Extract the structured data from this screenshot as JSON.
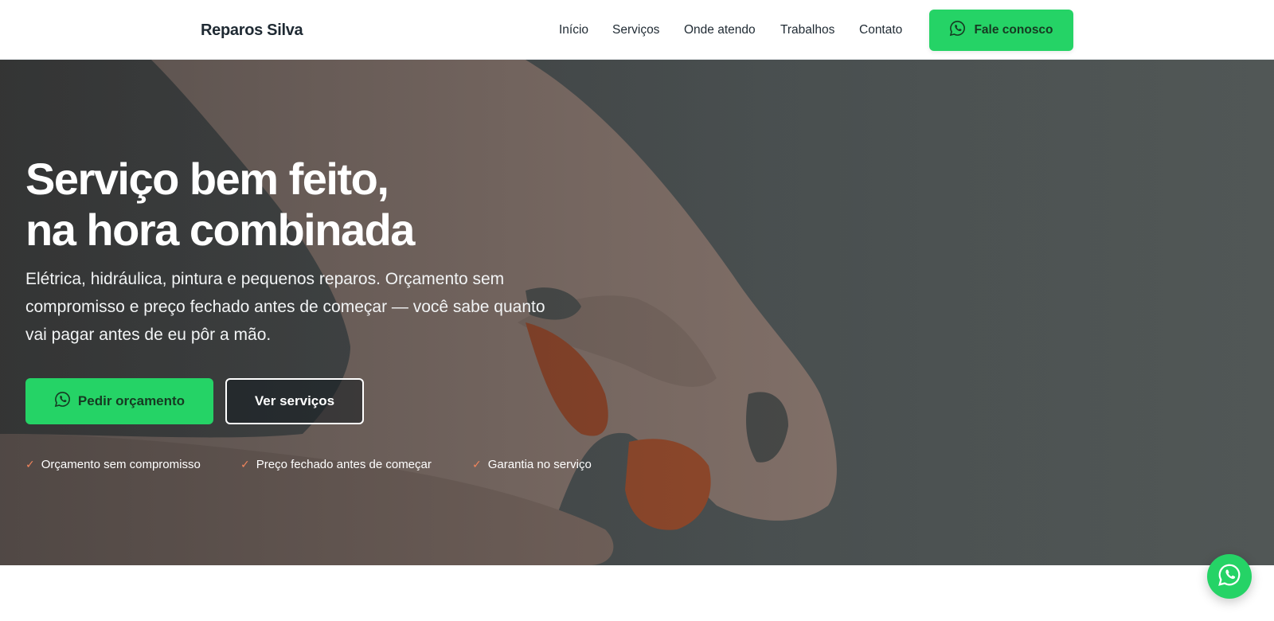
{
  "header": {
    "brand": "Reparos Silva",
    "nav": [
      "Início",
      "Serviços",
      "Onde atendo",
      "Trabalhos",
      "Contato"
    ],
    "cta_label": "Fale conosco",
    "cta_icon": "whatsapp-icon"
  },
  "hero": {
    "title_line1": "Serviço bem feito,",
    "title_line2": "na hora combinada",
    "subtitle": "Elétrica, hidráulica, pintura e pequenos reparos. Orçamento sem compromisso e preço fechado antes de começar — você sabe quanto vai pagar antes de eu pôr a mão.",
    "primary_button": "Pedir orçamento",
    "secondary_button": "Ver serviços",
    "badges": [
      "Orçamento sem compromisso",
      "Preço fechado antes de começar",
      "Garantia no serviço"
    ]
  },
  "floating": {
    "icon": "whatsapp-icon"
  },
  "colors": {
    "accent": "#25d366",
    "check": "#f0845c",
    "text_dark": "#1f2a33"
  }
}
